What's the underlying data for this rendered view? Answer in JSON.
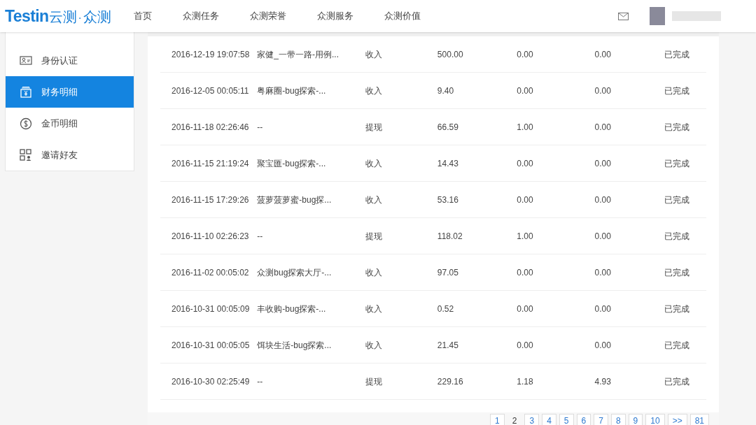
{
  "header": {
    "logo_latin": "Testin",
    "logo_cn": "云测",
    "logo_dot": "·",
    "logo_sub": "众测",
    "nav": [
      {
        "label": "首页"
      },
      {
        "label": "众测任务"
      },
      {
        "label": "众测荣誉"
      },
      {
        "label": "众测服务"
      },
      {
        "label": "众测价值"
      }
    ]
  },
  "sidebar": {
    "items": [
      {
        "label": "身份认证",
        "kind": "id-card",
        "selected": false
      },
      {
        "label": "财务明细",
        "kind": "wallet",
        "selected": true
      },
      {
        "label": "金币明细",
        "kind": "coin",
        "selected": false
      },
      {
        "label": "邀请好友",
        "kind": "qr",
        "selected": false
      }
    ]
  },
  "table": {
    "rows": [
      {
        "column_1": "2016-12-19 19:07:58",
        "column_2": "家健_一带一路-用例...",
        "column_3": "收入",
        "column_4": "500.00",
        "column_5": "0.00",
        "column_6": "0.00",
        "column_7": "已完成"
      },
      {
        "column_1": "2016-12-05 00:05:11",
        "column_2": "粤麻圈-bug探索-...",
        "column_3": "收入",
        "column_4": "9.40",
        "column_5": "0.00",
        "column_6": "0.00",
        "column_7": "已完成"
      },
      {
        "column_1": "2016-11-18 02:26:46",
        "column_2": "--",
        "column_3": "提现",
        "column_4": "66.59",
        "column_5": "1.00",
        "column_6": "0.00",
        "column_7": "已完成"
      },
      {
        "column_1": "2016-11-15 21:19:24",
        "column_2": "聚宝匯-bug探索-...",
        "column_3": "收入",
        "column_4": "14.43",
        "column_5": "0.00",
        "column_6": "0.00",
        "column_7": "已完成"
      },
      {
        "column_1": "2016-11-15 17:29:26",
        "column_2": "菠萝菠萝蜜-bug探...",
        "column_3": "收入",
        "column_4": "53.16",
        "column_5": "0.00",
        "column_6": "0.00",
        "column_7": "已完成"
      },
      {
        "column_1": "2016-11-10 02:26:23",
        "column_2": "--",
        "column_3": "提现",
        "column_4": "118.02",
        "column_5": "1.00",
        "column_6": "0.00",
        "column_7": "已完成"
      },
      {
        "column_1": "2016-11-02 00:05:02",
        "column_2": "众测bug探索大厅-...",
        "column_3": "收入",
        "column_4": "97.05",
        "column_5": "0.00",
        "column_6": "0.00",
        "column_7": "已完成"
      },
      {
        "column_1": "2016-10-31 00:05:09",
        "column_2": "丰收购-bug探索-...",
        "column_3": "收入",
        "column_4": "0.52",
        "column_5": "0.00",
        "column_6": "0.00",
        "column_7": "已完成"
      },
      {
        "column_1": "2016-10-31 00:05:05",
        "column_2": "饵块生活-bug探索...",
        "column_3": "收入",
        "column_4": "21.45",
        "column_5": "0.00",
        "column_6": "0.00",
        "column_7": "已完成"
      },
      {
        "column_1": "2016-10-30 02:25:49",
        "column_2": "--",
        "column_3": "提现",
        "column_4": "229.16",
        "column_5": "1.18",
        "column_6": "4.93",
        "column_7": "已完成"
      }
    ]
  },
  "pagination": [
    {
      "label": "1",
      "selected": false
    },
    {
      "label": "2",
      "selected": true
    },
    {
      "label": "3",
      "selected": false
    },
    {
      "label": "4",
      "selected": false
    },
    {
      "label": "5",
      "selected": false
    },
    {
      "label": "6",
      "selected": false
    },
    {
      "label": "7",
      "selected": false
    },
    {
      "label": "8",
      "selected": false
    },
    {
      "label": "9",
      "selected": false
    },
    {
      "label": "10",
      "selected": false
    },
    {
      "label": ">>",
      "selected": false
    },
    {
      "label": "81",
      "selected": false
    }
  ]
}
